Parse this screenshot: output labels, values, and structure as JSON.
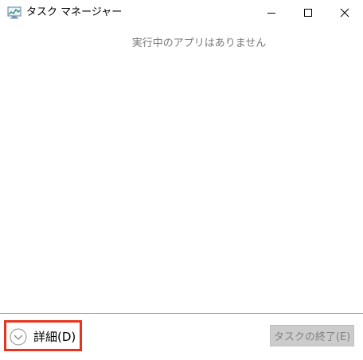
{
  "window": {
    "title": "タスク マネージャー",
    "icon": "task-manager-icon"
  },
  "titlebar_buttons": {
    "minimize_icon": "minimize-icon",
    "maximize_icon": "maximize-icon",
    "close_icon": "close-icon"
  },
  "content": {
    "empty_message": "実行中のアプリはありません"
  },
  "footer": {
    "details_label": "詳細(D)",
    "details_icon": "chevron-down-circle-icon",
    "end_task_label": "タスクの終了(E)"
  },
  "colors": {
    "highlight": "#e8341c",
    "disabled_bg": "#cccccc",
    "disabled_text": "#838383",
    "muted_text": "#7a7a7a"
  }
}
